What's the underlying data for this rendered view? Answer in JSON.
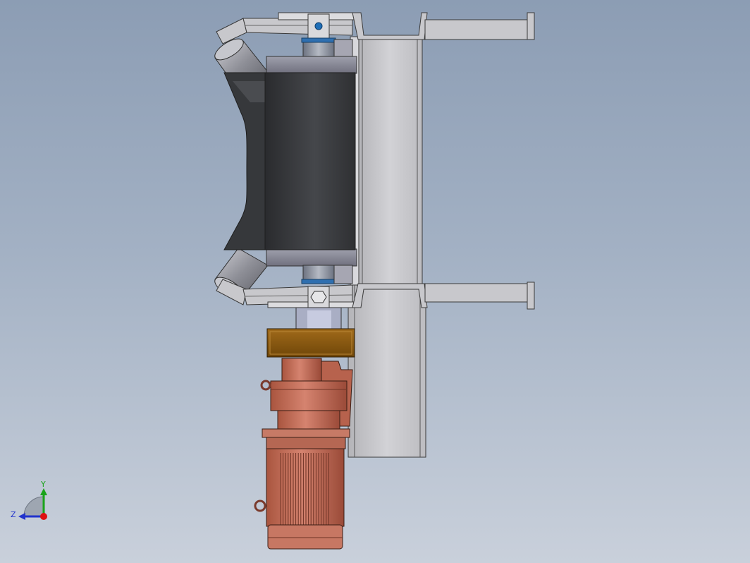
{
  "viewport": {
    "background_top": "#8c9db4",
    "background_bottom": "#c9d0db"
  },
  "model": {
    "steel_color": "#c4c4c4",
    "roller_color": "#3b3d40",
    "roller_shell_color": "#8d8d99",
    "mount_block_color": "#8a5a12",
    "motor_color": "#c46f5c",
    "bearing_color": "#2f6fb0"
  },
  "triad": {
    "y_label": "Y",
    "z_label": "Z",
    "y_color": "#1aa31a",
    "z_color": "#2233cc",
    "x_color": "#dd1111"
  }
}
